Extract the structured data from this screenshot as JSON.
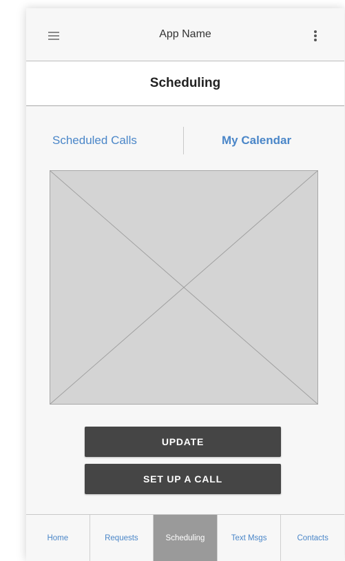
{
  "app_bar": {
    "title": "App Name",
    "menu_icon": "hamburger-menu-icon",
    "overflow_icon": "more-vertical-icon"
  },
  "page": {
    "title": "Scheduling"
  },
  "tabs": [
    {
      "label": "Scheduled Calls",
      "selected": false
    },
    {
      "label": "My Calendar",
      "selected": true
    }
  ],
  "image_placeholder": {
    "icon": "image-placeholder-icon"
  },
  "buttons": {
    "update_label": "UPDATE",
    "setup_call_label": "SET UP A CALL"
  },
  "bottom_nav": {
    "items": [
      {
        "label": "Home"
      },
      {
        "label": "Requests"
      },
      {
        "label": "Scheduling"
      },
      {
        "label": "Text Msgs"
      },
      {
        "label": "Contacts"
      }
    ],
    "active": "Scheduling"
  },
  "colors": {
    "accent": "#4a86c8",
    "button": "#454545",
    "active_tab_background": "#9a9a9a",
    "placeholder_fill": "#d4d4d4"
  }
}
